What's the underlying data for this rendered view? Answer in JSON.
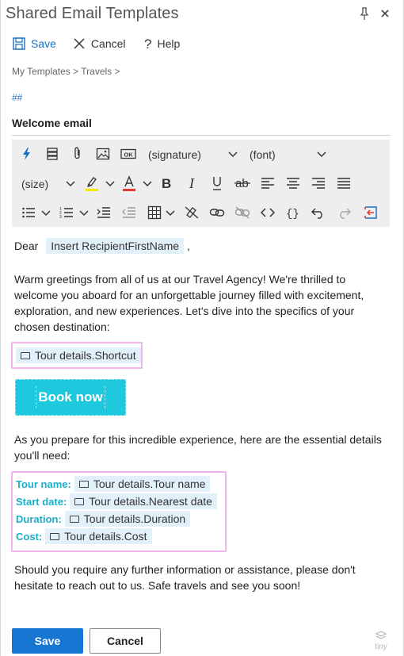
{
  "window": {
    "title": "Shared Email Templates"
  },
  "commands": {
    "save": "Save",
    "cancel": "Cancel",
    "help": "Help"
  },
  "breadcrumb": "My Templates > Travels >",
  "hashes": "##",
  "template_name": "Welcome email",
  "toolbar": {
    "signature_select": "(signature)",
    "font_select": "(font)",
    "size_select": "(size)",
    "icons": [
      "lightning-icon",
      "database-icon",
      "paperclip-icon",
      "image-icon",
      "ok-icon",
      "highlight-icon",
      "font-color-icon",
      "bold-icon",
      "italic-icon",
      "underline-icon",
      "strikethrough-icon",
      "align-left-icon",
      "align-center-icon",
      "align-right-icon",
      "justify-icon",
      "bullet-list-icon",
      "numbered-list-icon",
      "indent-icon",
      "outdent-icon",
      "table-icon",
      "clear-format-icon",
      "link-icon",
      "unlink-icon",
      "code-icon",
      "braces-icon",
      "undo-icon",
      "redo-icon",
      "insert-icon"
    ],
    "highlight_color": "#f5e500",
    "font_color": "#e53935"
  },
  "editor": {
    "dear": "Dear",
    "recipient_macro": "Insert RecipientFirstName",
    "comma": ",",
    "paragraph1": "Warm greetings from all of us at our Travel Agency! We're thrilled to welcome you aboard for an unforgettable journey filled with excitement, exploration, and new experiences. Let's dive into the specifics of your chosen destination:",
    "shortcut_chip": "Tour details.Shortcut",
    "book_button": "Book now",
    "paragraph2": "As you prepare for this incredible experience, here are the essential details you'll need:",
    "details": [
      {
        "label": "Tour name:",
        "chip": "Tour details.Tour name"
      },
      {
        "label": "Start date:",
        "chip": "Tour details.Nearest date"
      },
      {
        "label": "Duration:",
        "chip": "Tour details.Duration"
      },
      {
        "label": "Cost:",
        "chip": "Tour details.Cost"
      }
    ],
    "paragraph3": "Should you require any further information or assistance, please don't hesitate to reach out to us. Safe travels and see you soon!"
  },
  "footer": {
    "save": "Save",
    "cancel": "Cancel",
    "brand": "tiny"
  },
  "colors": {
    "accent": "#1776d2",
    "book_button": "#1ec9dd",
    "highlight_box": "#f0b5ef",
    "detail_label": "#1aafc9",
    "chip_bg": "#e2f0fa"
  }
}
